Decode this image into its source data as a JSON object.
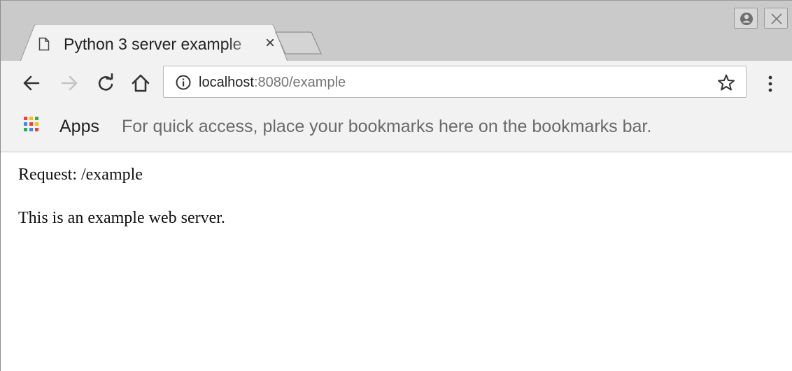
{
  "browser": {
    "tab": {
      "title": "Python 3 server example",
      "close_glyph": "×",
      "favicon": "page-icon"
    },
    "window_buttons": [
      "profile-icon",
      "close-icon"
    ],
    "toolbar": {
      "back_icon": "arrow-left-icon",
      "forward_icon": "arrow-right-icon",
      "reload_icon": "reload-icon",
      "home_icon": "home-icon",
      "site_info_icon": "info-icon",
      "url_host": "localhost",
      "url_rest": ":8080/example",
      "bookmark_icon": "star-icon",
      "menu_icon": "kebab-menu-icon"
    },
    "bookmarks_bar": {
      "apps_label": "Apps",
      "hint": "For quick access, place your bookmarks here on the bookmarks bar."
    }
  },
  "page": {
    "request_line": "Request: /example",
    "body_text": "This is an example web server."
  },
  "colors": {
    "tabstrip": "#cacaca",
    "toolbar": "#f2f2f2",
    "apps_dots": [
      "#ea4335",
      "#fbbc05",
      "#34a853",
      "#4285f4"
    ]
  }
}
